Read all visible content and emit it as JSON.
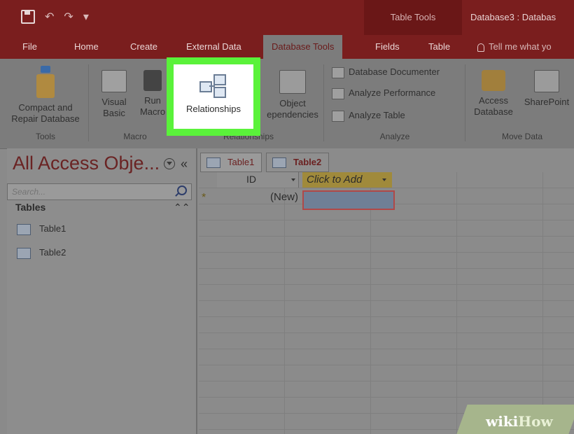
{
  "titlebar": {
    "table_tools": "Table Tools",
    "document_title": "Database3 : Databas"
  },
  "tabs": [
    {
      "label": "File"
    },
    {
      "label": "Home"
    },
    {
      "label": "Create"
    },
    {
      "label": "External Data"
    },
    {
      "label": "Database Tools",
      "active": true
    },
    {
      "label": "Fields"
    },
    {
      "label": "Table"
    }
  ],
  "tell_me": "Tell me what yo",
  "ribbon": {
    "compact": {
      "line1": "Compact and",
      "line2": "Repair Database"
    },
    "visual_basic": {
      "line1": "Visual",
      "line2": "Basic"
    },
    "run_macro": {
      "line1": "Run",
      "line2": "Macro"
    },
    "relationships": "Relationships",
    "object_dependencies": {
      "line1": "Object",
      "line2": "ependencies"
    },
    "analyze": {
      "documenter": "Database Documenter",
      "performance": "Analyze Performance",
      "table": "Analyze Table"
    },
    "access_database": {
      "line1": "Access",
      "line2": "Database"
    },
    "sharepoint": "SharePoint",
    "groups": {
      "tools": "Tools",
      "macro": "Macro",
      "relationships": "Relationships",
      "analyze": "Analyze",
      "move_data": "Move Data"
    }
  },
  "nav": {
    "title": "All Access Obje...",
    "collapse": "«",
    "search_placeholder": "Search...",
    "section": "Tables",
    "section_toggle": "⌃⌃",
    "items": [
      "Table1",
      "Table2"
    ]
  },
  "doc_tabs": [
    "Table1",
    "Table2"
  ],
  "datasheet": {
    "col_id": "ID",
    "col_add": "Click to Add",
    "new_row_marker": "*",
    "new_value": "(New)"
  },
  "watermark": {
    "wiki": "wiki",
    "how": "How"
  }
}
